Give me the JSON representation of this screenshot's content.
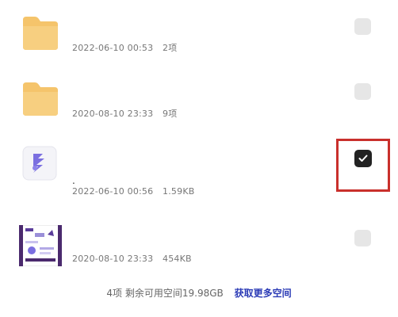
{
  "files": [
    {
      "date": "2022-06-10 00:53",
      "info": "2项",
      "type": "folder",
      "selected": false
    },
    {
      "date": "2020-08-10 23:33",
      "info": "9项",
      "type": "folder",
      "selected": false
    },
    {
      "name": ".",
      "date": "2022-06-10 00:56",
      "info": "1.59KB",
      "type": "app-file",
      "selected": true
    },
    {
      "date": "2020-08-10 23:33",
      "info": "454KB",
      "type": "image",
      "selected": false
    }
  ],
  "footer": {
    "summary": "4项 剩余可用空间19.98GB",
    "action": "获取更多空间"
  },
  "colors": {
    "folder": "#f5c46b",
    "checked": "#222222",
    "unchecked": "#e6e6e6",
    "link": "#2b3bb6",
    "highlight": "#c9302c",
    "app_icon": "#7b6fe0"
  }
}
